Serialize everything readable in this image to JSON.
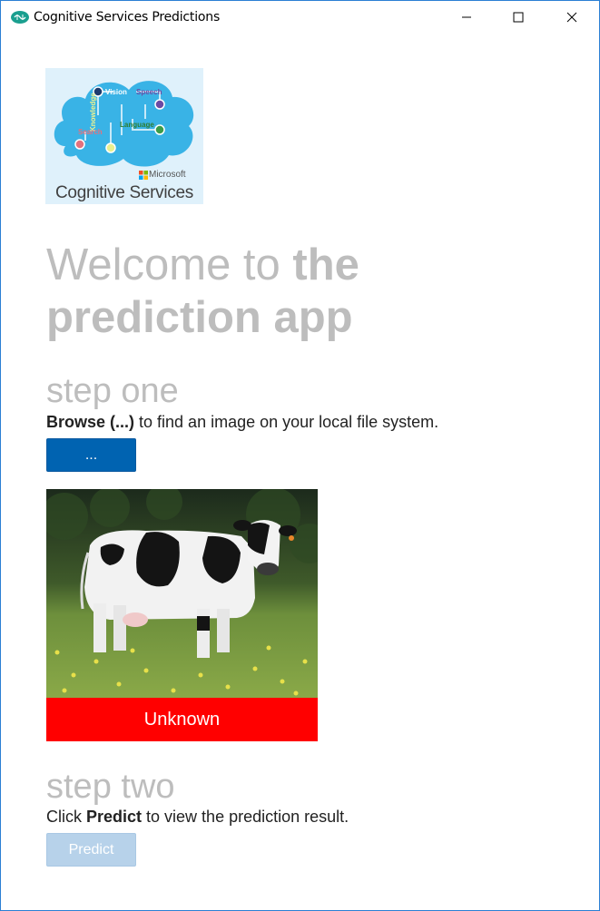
{
  "window": {
    "title": "Cognitive Services Predictions",
    "app_icon": "brain-icon",
    "controls": {
      "minimize_icon": "minimize-icon",
      "maximize_icon": "maximize-icon",
      "close_icon": "close-icon"
    }
  },
  "logo": {
    "caption": "Cognitive Services",
    "brand": "Microsoft",
    "labels": [
      "Vision",
      "Speech",
      "Knowledge",
      "Language",
      "Search"
    ]
  },
  "welcome": {
    "prefix": "Welcome to ",
    "bold": "the prediction app"
  },
  "step_one": {
    "heading": "step one",
    "instruction_bold": "Browse (...)",
    "instruction_rest": " to find an image on your local file system.",
    "browse_label": "..."
  },
  "preview": {
    "result_label": "Unknown",
    "result_color": "#ff0000"
  },
  "step_two": {
    "heading": "step two",
    "instruction_pre": "Click ",
    "instruction_bold": "Predict",
    "instruction_rest": " to view the prediction result.",
    "predict_label": "Predict"
  },
  "colors": {
    "accent": "#0063b1",
    "disabled_button": "#b7d2ea",
    "heading_gray": "#bdbdbd",
    "border": "#2b7fd4"
  }
}
